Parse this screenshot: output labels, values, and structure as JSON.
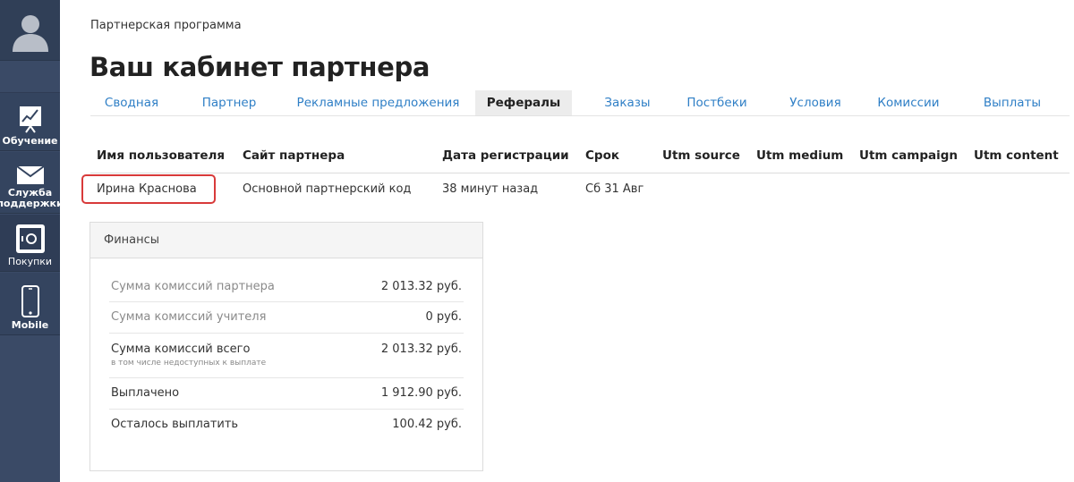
{
  "sidebar": {
    "items": [
      {
        "label": "Обучение",
        "icon": "chart-board-icon"
      },
      {
        "label_line1": "Служба",
        "label_line2": "поддержки",
        "icon": "envelope-icon"
      },
      {
        "label": "Покупки",
        "icon": "safe-icon"
      },
      {
        "label": "Mobile",
        "icon": "phone-icon"
      }
    ]
  },
  "header": {
    "breadcrumb": "Партнерская программа",
    "title": "Ваш кабинет партнера"
  },
  "tabs": [
    {
      "label": "Сводная",
      "active": false
    },
    {
      "label": "Партнер",
      "active": false
    },
    {
      "label": "Рекламные предложения",
      "active": false
    },
    {
      "label": "Рефералы",
      "active": true
    },
    {
      "label": "Заказы",
      "active": false
    },
    {
      "label": "Постбеки",
      "active": false
    },
    {
      "label": "Условия",
      "active": false
    },
    {
      "label": "Комиссии",
      "active": false
    },
    {
      "label": "Выплаты",
      "active": false
    }
  ],
  "table": {
    "columns": [
      "Имя пользователя",
      "Сайт партнера",
      "Дата регистрации",
      "Срок",
      "Utm source",
      "Utm medium",
      "Utm campaign",
      "Utm content"
    ],
    "rows": [
      [
        "Ирина Краснова",
        "Основной партнерский код",
        "38 минут назад",
        "Сб 31 Авг",
        "",
        "",
        "",
        ""
      ]
    ]
  },
  "finance": {
    "title": "Финансы",
    "rows": [
      {
        "label": "Сумма комиссий партнера",
        "value": "2 013.32 руб."
      },
      {
        "label": "Сумма комиссий учителя",
        "value": "0 руб."
      },
      {
        "label": "Сумма комиссий всего",
        "note": "в том числе недоступных к выплате",
        "value": "2 013.32 руб."
      },
      {
        "label": "Выплачено",
        "value": "1 912.90 руб."
      },
      {
        "label": "Осталось выплатить",
        "value": "100.42 руб."
      }
    ]
  },
  "colors": {
    "sidebar": "#3a4a66",
    "tab_link": "#2f7fc6",
    "highlight": "#d83a3a"
  }
}
